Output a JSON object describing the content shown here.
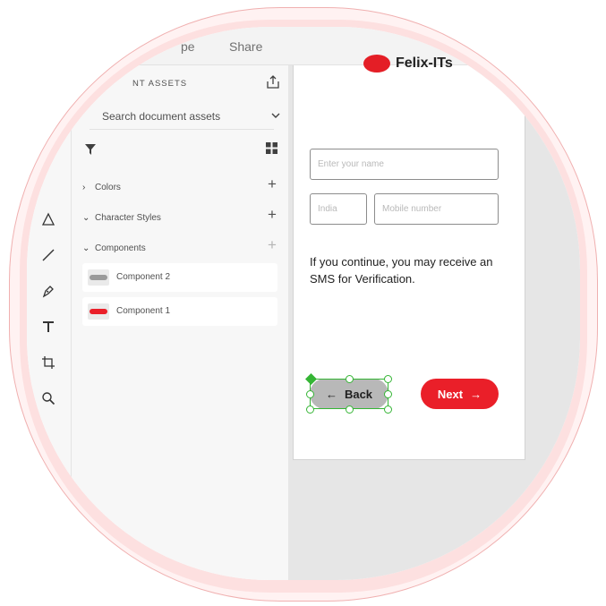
{
  "header": {
    "tabs": [
      "pe",
      "Share"
    ]
  },
  "assets": {
    "title": "NT ASSETS",
    "search_placeholder": "Search document assets",
    "sections": [
      {
        "label": "Colors",
        "expanded": false
      },
      {
        "label": "Character Styles",
        "expanded": true
      },
      {
        "label": "Components",
        "expanded": true
      }
    ],
    "components": [
      {
        "label": "Component 2",
        "thumb_color": "#9a9a9a"
      },
      {
        "label": "Component 1",
        "thumb_color": "#ea1f29"
      }
    ]
  },
  "artboard": {
    "logo_text": "Felix-ITs",
    "name_placeholder": "Enter your name",
    "country_placeholder": "India",
    "mobile_placeholder": "Mobile number",
    "info_text": "If you continue, you may receive an SMS for Verification.",
    "back_label": "Back",
    "next_label": "Next"
  },
  "colors": {
    "accent": "#ea1f29",
    "selection": "#35b535",
    "back_button": "#b8b8b8"
  },
  "icons": [
    "triangle-icon",
    "line-icon",
    "pen-icon",
    "text-icon",
    "artboard-icon",
    "zoom-icon",
    "export-icon",
    "chevron-down-icon",
    "filter-icon",
    "grid-icon",
    "arrow-left-icon",
    "arrow-right-icon"
  ]
}
